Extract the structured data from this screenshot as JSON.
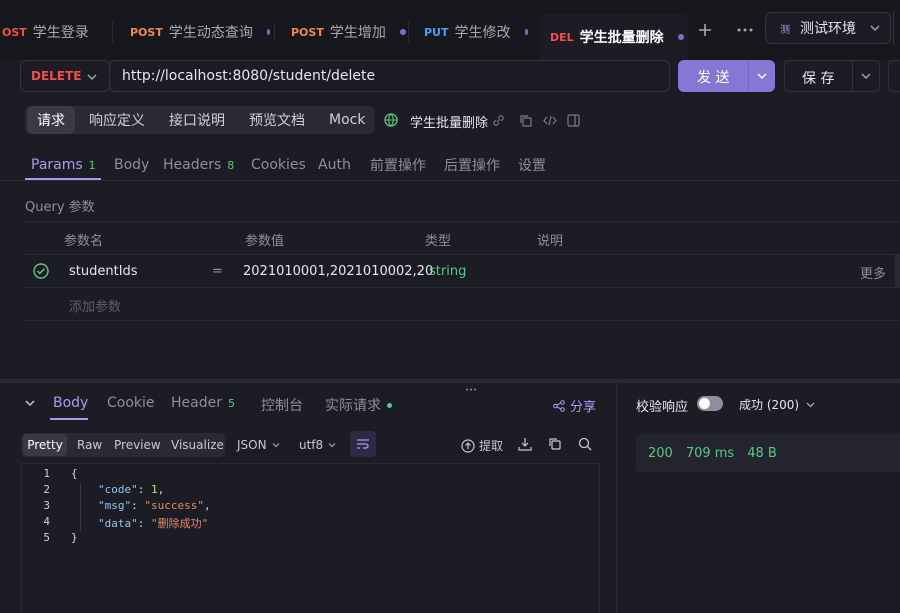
{
  "tabs": [
    {
      "method": "OST",
      "label": "学生登录"
    },
    {
      "method": "POST",
      "label": "学生动态查询"
    },
    {
      "method": "POST",
      "label": "学生增加"
    },
    {
      "method": "PUT",
      "label": "学生修改"
    },
    {
      "method": "DEL",
      "label": "学生批量删除"
    }
  ],
  "env": {
    "badge": "测",
    "label": "测试环境"
  },
  "request": {
    "method": "DELETE",
    "url": "http://localhost:8080/student/delete",
    "send_label": "发 送",
    "save_label": "保 存"
  },
  "subtabs": [
    "请求",
    "响应定义",
    "接口说明",
    "预览文档",
    "Mock"
  ],
  "api_name": "学生批量删除",
  "param_tabs": {
    "params": "Params",
    "params_count": "1",
    "body": "Body",
    "headers": "Headers",
    "headers_count": "8",
    "cookies": "Cookies",
    "auth": "Auth",
    "pre": "前置操作",
    "post": "后置操作",
    "settings": "设置"
  },
  "query": {
    "section_title": "Query 参数",
    "headers": {
      "name": "参数名",
      "value": "参数值",
      "type": "类型",
      "desc": "说明"
    },
    "rows": [
      {
        "name": "studentIds",
        "eq": "=",
        "value": "2021010001,2021010002,20",
        "type": "string",
        "more": "更多"
      }
    ],
    "add_label": "添加参数"
  },
  "response": {
    "tabs": {
      "body": "Body",
      "cookie": "Cookie",
      "header": "Header",
      "header_count": "5",
      "console": "控制台",
      "actual": "实际请求"
    },
    "share": "分享",
    "view_tabs": [
      "Pretty",
      "Raw",
      "Preview",
      "Visualize"
    ],
    "format": "JSON",
    "encoding": "utf8",
    "extract": "提取",
    "validate_label": "校验响应",
    "result_label": "成功 (200)",
    "status": "200",
    "time": "709 ms",
    "size": "48 B",
    "lines": [
      "1",
      "2",
      "3",
      "4",
      "5"
    ],
    "json": {
      "open": "{",
      "code_key": "\"code\"",
      "code_val": "1",
      "msg_key": "\"msg\"",
      "msg_val": "\"success\"",
      "data_key": "\"data\"",
      "data_val": "\"删除成功\"",
      "close": "}"
    }
  },
  "colors": {
    "accent": "#8677d4",
    "delete": "#f0504c",
    "post": "#f08a4b",
    "put": "#4a9ff5",
    "success": "#5ac983"
  }
}
